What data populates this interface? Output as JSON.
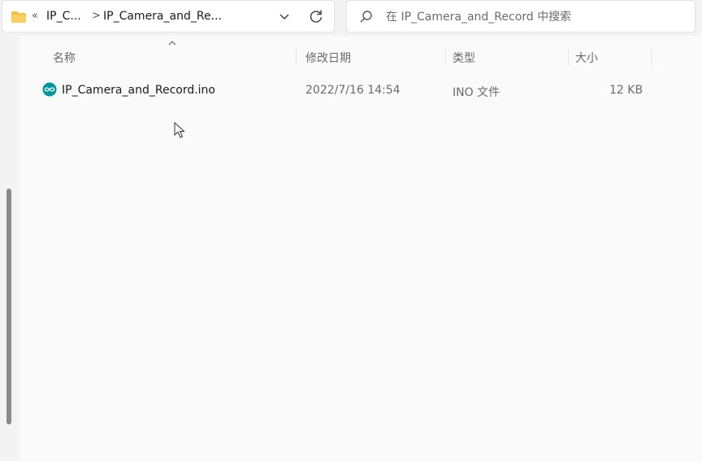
{
  "address_bar": {
    "overflow": "«",
    "crumbs": [
      "IP_C...",
      "IP_Camera_and_Re..."
    ],
    "separator": ">"
  },
  "search": {
    "placeholder": "在 IP_Camera_and_Record 中搜索"
  },
  "columns": {
    "name": "名称",
    "date": "修改日期",
    "type": "类型",
    "size": "大小"
  },
  "files": [
    {
      "name": "IP_Camera_and_Record.ino",
      "date": "2022/7/16 14:54",
      "type": "INO 文件",
      "size": "12 KB",
      "icon": "arduino-file-icon"
    }
  ],
  "colors": {
    "folder": "#f4c042",
    "arduino": "#00979c"
  }
}
